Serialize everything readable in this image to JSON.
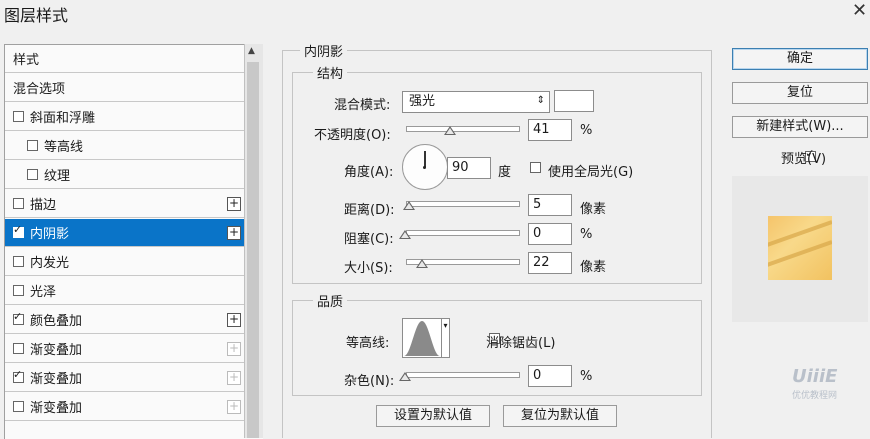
{
  "window": {
    "title": "图层样式"
  },
  "left_panel": {
    "items": [
      {
        "label": "样式",
        "checkbox": false,
        "checked": false,
        "indent": 0,
        "plus": null,
        "selected": false
      },
      {
        "label": "混合选项",
        "checkbox": false,
        "checked": false,
        "indent": 0,
        "plus": null,
        "selected": false
      },
      {
        "label": "斜面和浮雕",
        "checkbox": true,
        "checked": false,
        "indent": 0,
        "plus": null,
        "selected": false
      },
      {
        "label": "等高线",
        "checkbox": true,
        "checked": false,
        "indent": 1,
        "plus": null,
        "selected": false
      },
      {
        "label": "纹理",
        "checkbox": true,
        "checked": false,
        "indent": 1,
        "plus": null,
        "selected": false
      },
      {
        "label": "描边",
        "checkbox": true,
        "checked": false,
        "indent": 0,
        "plus": "enabled",
        "selected": false
      },
      {
        "label": "内阴影",
        "checkbox": true,
        "checked": true,
        "indent": 0,
        "plus": "enabled",
        "selected": true
      },
      {
        "label": "内发光",
        "checkbox": true,
        "checked": false,
        "indent": 0,
        "plus": null,
        "selected": false
      },
      {
        "label": "光泽",
        "checkbox": true,
        "checked": false,
        "indent": 0,
        "plus": null,
        "selected": false
      },
      {
        "label": "颜色叠加",
        "checkbox": true,
        "checked": true,
        "indent": 0,
        "plus": "enabled",
        "selected": false
      },
      {
        "label": "渐变叠加",
        "checkbox": true,
        "checked": false,
        "indent": 0,
        "plus": "disabled",
        "selected": false
      },
      {
        "label": "渐变叠加",
        "checkbox": true,
        "checked": true,
        "indent": 0,
        "plus": "disabled",
        "selected": false
      },
      {
        "label": "渐变叠加",
        "checkbox": true,
        "checked": false,
        "indent": 0,
        "plus": "disabled",
        "selected": false
      }
    ]
  },
  "inner_shadow": {
    "section_title": "内阴影",
    "structure": {
      "title": "结构",
      "blend_mode_label": "混合模式:",
      "blend_mode_value": "强光",
      "opacity_label": "不透明度(O):",
      "opacity_value": "41",
      "opacity_unit": "%",
      "angle_label": "角度(A):",
      "angle_value": "90",
      "angle_unit": "度",
      "global_light_label": "使用全局光(G)",
      "distance_label": "距离(D):",
      "distance_value": "5",
      "distance_unit": "像素",
      "choke_label": "阻塞(C):",
      "choke_value": "0",
      "choke_unit": "%",
      "size_label": "大小(S):",
      "size_value": "22",
      "size_unit": "像素"
    },
    "quality": {
      "title": "品质",
      "contour_label": "等高线:",
      "anti_alias_label": "消除锯齿(L)",
      "noise_label": "杂色(N):",
      "noise_value": "0",
      "noise_unit": "%"
    },
    "make_default": "设置为默认值",
    "reset_default": "复位为默认值"
  },
  "right_buttons": {
    "ok": "确定",
    "reset": "复位",
    "new_style": "新建样式(W)...",
    "preview_label": "预览(V)"
  },
  "watermark": {
    "logo": "UiiiE",
    "caption": "优优教程网"
  },
  "colors": {
    "selected": "#0a74c8",
    "swatch": "#f5c46a"
  }
}
